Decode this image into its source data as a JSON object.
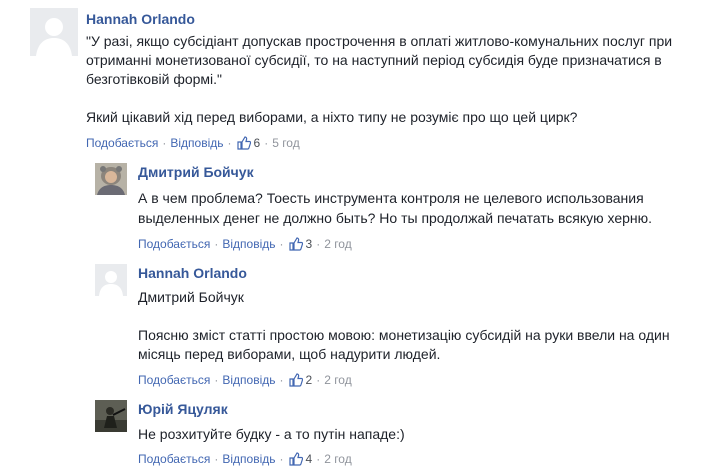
{
  "comments": [
    {
      "author": "Hannah Orlando",
      "paragraphs": [
        "\"У разі, якщо субсідіант допускав прострочення в оплаті житлово-комунальних послуг при отриманні монетизованої субсидії, то на наступний період субсидія буде призначатися в безготівковій формі.\"",
        "Який цікавий хід перед виборами, а ніхто типу не розуміє про що цей цирк?"
      ],
      "like_label": "Подобається",
      "reply_label": "Відповідь",
      "likes": "6",
      "time": "5 год",
      "avatar_icon": "default-profile-icon"
    },
    {
      "author": "Дмитрий Бойчук",
      "paragraphs": [
        "А в чем проблема? Тоесть инструмента контроля не целевого использования выделенных денег не должно быть? Но ты продолжай печатать всякую херню."
      ],
      "like_label": "Подобається",
      "reply_label": "Відповідь",
      "likes": "3",
      "time": "2 год",
      "avatar_icon": "photo-avatar"
    },
    {
      "author": "Hannah Orlando",
      "paragraphs": [
        "Дмитрий Бойчук",
        "Поясню зміст статті простою мовою: монетизацію субсидій на руки ввели на один місяць перед виборами, щоб надурити людей."
      ],
      "like_label": "Подобається",
      "reply_label": "Відповідь",
      "likes": "2",
      "time": "2 год",
      "avatar_icon": "default-profile-icon"
    },
    {
      "author": "Юрій Яцуляк",
      "paragraphs": [
        "Не розхитуйте будку - а то путін нападе:)"
      ],
      "like_label": "Подобається",
      "reply_label": "Відповідь",
      "likes": "4",
      "time": "2 год",
      "avatar_icon": "photo-avatar"
    }
  ],
  "separator": "·",
  "colors": {
    "author": "#365899",
    "link": "#4267b2",
    "meta": "#90949c",
    "avatar_bg": "#e9ebee",
    "avatar_silhouette": "#ffffff"
  }
}
